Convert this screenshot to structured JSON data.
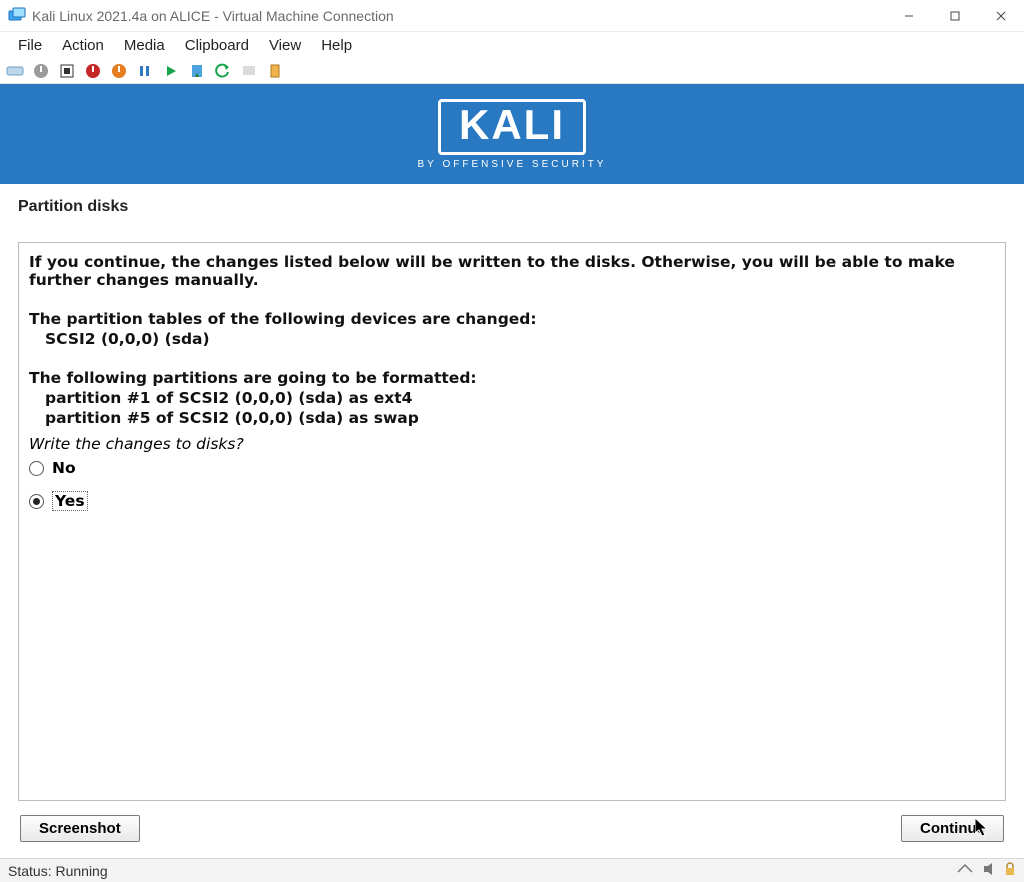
{
  "window": {
    "title": "Kali Linux 2021.4a on ALICE - Virtual Machine Connection"
  },
  "menu": {
    "file": "File",
    "action": "Action",
    "media": "Media",
    "clipboard": "Clipboard",
    "view": "View",
    "help": "Help"
  },
  "banner": {
    "logo_text": "KALI",
    "subtitle": "BY OFFENSIVE SECURITY"
  },
  "installer": {
    "title": "Partition disks",
    "warning": "If you continue, the changes listed below will be written to the disks. Otherwise, you will be able to make further changes manually.",
    "tables_heading": "The partition tables of the following devices are changed:",
    "tables_item1": "SCSI2 (0,0,0) (sda)",
    "format_heading": "The following partitions are going to be formatted:",
    "format_item1": "partition #1 of SCSI2 (0,0,0) (sda) as ext4",
    "format_item2": "partition #5 of SCSI2 (0,0,0) (sda) as swap",
    "question": "Write the changes to disks?",
    "option_no": "No",
    "option_yes": "Yes",
    "selected": "yes"
  },
  "buttons": {
    "screenshot": "Screenshot",
    "continue": "Continue"
  },
  "status": {
    "text": "Status: Running"
  }
}
